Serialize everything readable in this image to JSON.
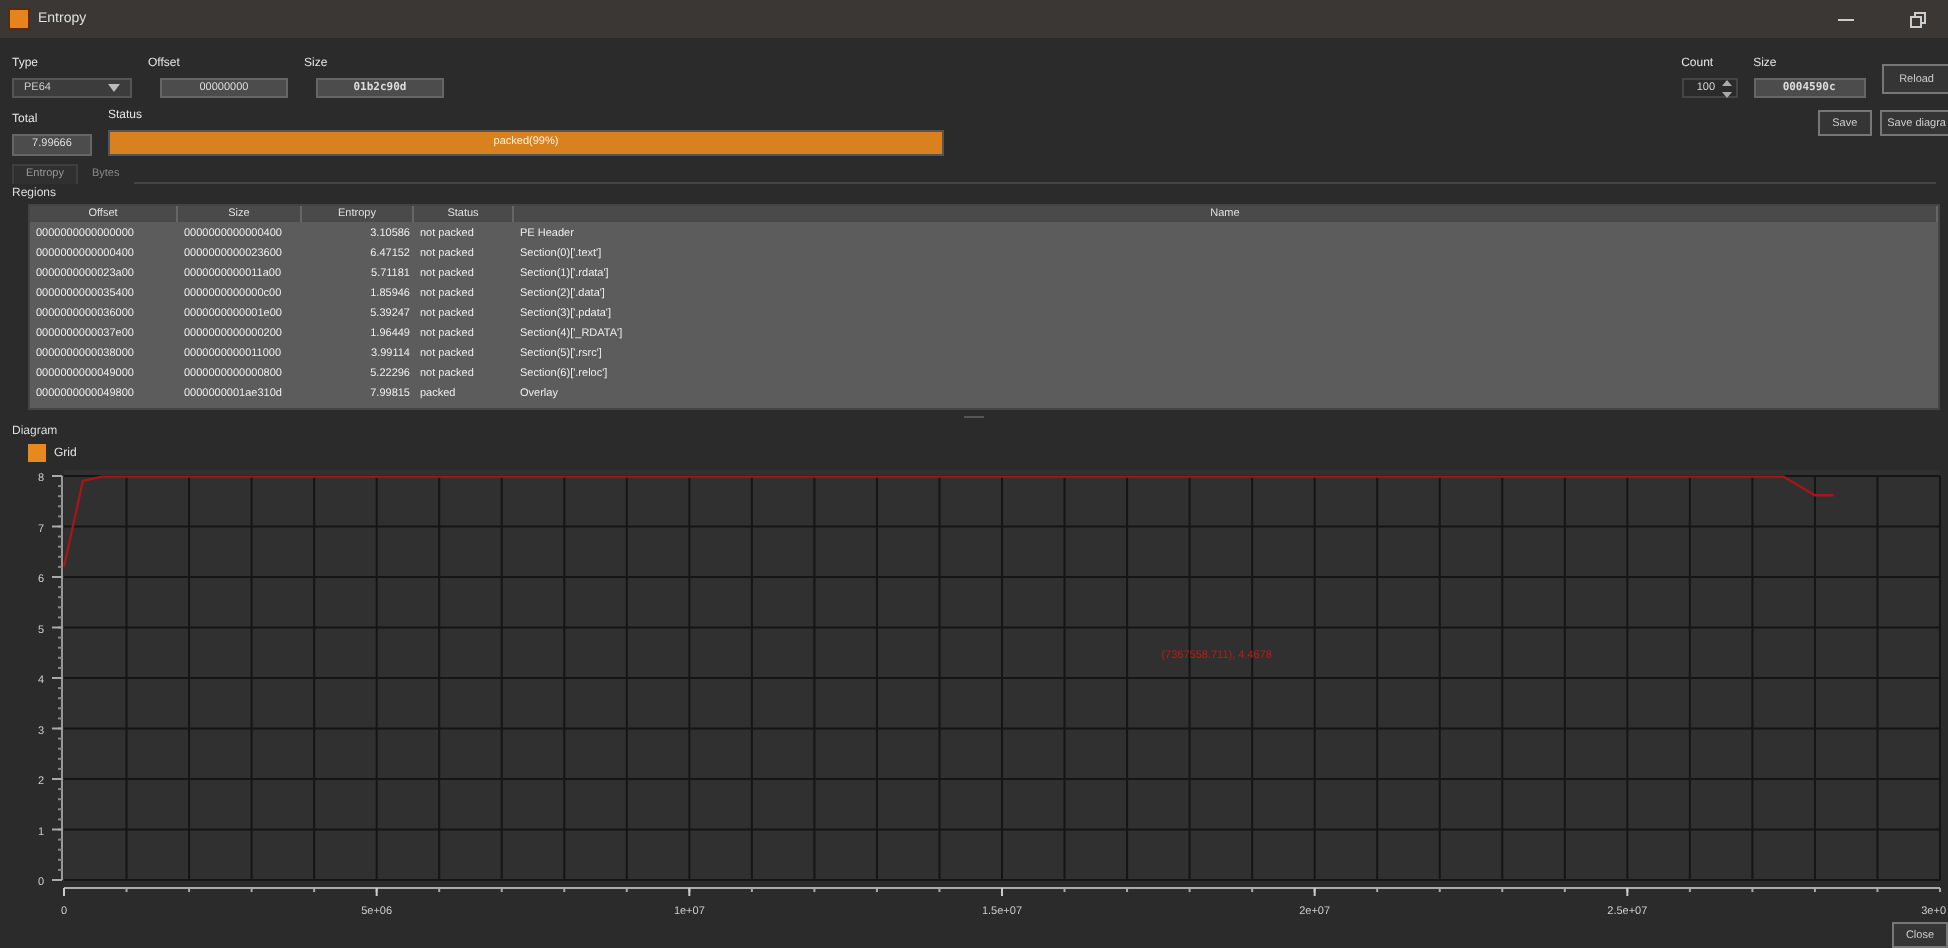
{
  "window": {
    "title": "Entropy"
  },
  "type_field": {
    "label": "Type",
    "value": "PE64"
  },
  "offset_field": {
    "label": "Offset",
    "value": "00000000"
  },
  "size_field": {
    "label": "Size",
    "value": "01b2c90d"
  },
  "count_field": {
    "label": "Count",
    "value": "100"
  },
  "block_size_field": {
    "label": "Size",
    "value": "0004590c"
  },
  "reload_button": "Reload",
  "total_field": {
    "label": "Total",
    "value": "7.99666"
  },
  "status": {
    "label": "Status",
    "text": "packed(99%)",
    "level": 1
  },
  "save_button": "Save",
  "save_diagram_button": "Save diagra",
  "tabs": [
    {
      "label": "Entropy",
      "selected": true
    },
    {
      "label": "Bytes",
      "selected": false
    }
  ],
  "regions": {
    "title": "Regions",
    "columns": [
      "Offset",
      "Size",
      "Entropy",
      "Status",
      "Name"
    ],
    "rows": [
      [
        "0000000000000000",
        "0000000000000400",
        "3.10586",
        "not packed",
        "PE Header"
      ],
      [
        "0000000000000400",
        "0000000000023600",
        "6.47152",
        "not packed",
        "Section(0)['.text']"
      ],
      [
        "0000000000023a00",
        "0000000000011a00",
        "5.71181",
        "not packed",
        "Section(1)['.rdata']"
      ],
      [
        "0000000000035400",
        "0000000000000c00",
        "1.85946",
        "not packed",
        "Section(2)['.data']"
      ],
      [
        "0000000000036000",
        "0000000000001e00",
        "5.39247",
        "not packed",
        "Section(3)['.pdata']"
      ],
      [
        "0000000000037e00",
        "0000000000000200",
        "1.96449",
        "not packed",
        "Section(4)['_RDATA']"
      ],
      [
        "0000000000038000",
        "0000000000011000",
        "3.99114",
        "not packed",
        "Section(5)['.rsrc']"
      ],
      [
        "0000000000049000",
        "0000000000000800",
        "5.22296",
        "not packed",
        "Section(6)['.reloc']"
      ],
      [
        "0000000000049800",
        "0000000001ae310d",
        "7.99815",
        "packed",
        "Overlay"
      ]
    ]
  },
  "diagram": {
    "title": "Diagram",
    "legend": {
      "label": "Grid",
      "checked": true
    },
    "chart_data": {
      "type": "line",
      "x": [
        0,
        300000,
        600000,
        27500000,
        28000000,
        28300000
      ],
      "series": [
        {
          "color": "#a01818",
          "values": [
            6.2,
            7.9,
            7.99,
            7.99,
            7.62,
            7.62
          ]
        }
      ],
      "grid": true,
      "xlim": [
        0,
        30000000
      ],
      "ylim": [
        0,
        8
      ],
      "xticks": [
        {
          "value": 0,
          "label": "0"
        },
        {
          "value": 5000000,
          "label": "5e+06"
        },
        {
          "value": 10000000,
          "label": "1e+07"
        },
        {
          "value": 15000000,
          "label": "1.5e+07"
        },
        {
          "value": 20000000,
          "label": "2e+07"
        },
        {
          "value": 25000000,
          "label": "2.5e+07"
        }
      ],
      "yticks": [
        0,
        1,
        2,
        3,
        4,
        5,
        6,
        7,
        8
      ],
      "annotations": [
        "(7367558.711), 4.4678"
      ]
    },
    "edge_tick_label": "3e+0"
  },
  "close_button": "Close"
}
